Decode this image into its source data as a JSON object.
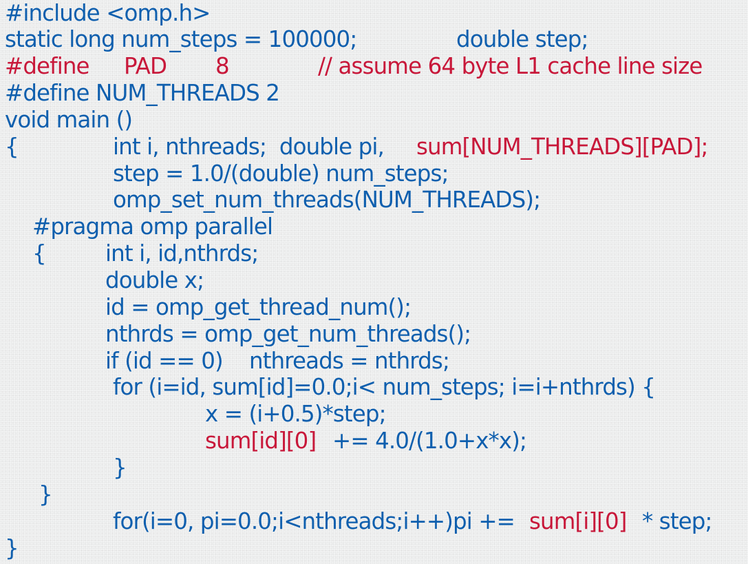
{
  "colors": {
    "code_blue": "#0f5fae",
    "highlight_red": "#c8183a",
    "background": "#f2f3f3"
  },
  "lines": {
    "l1": "#include <omp.h>",
    "l2a": "static long num_steps = 100000;",
    "l2b": "double step;",
    "l3a": "#define",
    "l3b": "PAD",
    "l3c": "8",
    "l3d": "// assume 64 byte L1 cache line size",
    "l4": "#define NUM_THREADS 2",
    "l5": "void main ()",
    "l6a": "{",
    "l6b": "int i, nthreads;  double pi,",
    "l6c": "sum[NUM_THREADS][PAD];",
    "l7": "step = 1.0/(double) num_steps;",
    "l8": "omp_set_num_threads(NUM_THREADS);",
    "l9": "#pragma omp parallel",
    "l10a": "{",
    "l10b": "int i, id,nthrds;",
    "l11": "double x;",
    "l12": "id = omp_get_thread_num();",
    "l13": "nthrds = omp_get_num_threads();",
    "l14a": "if (id == 0)",
    "l14b": "nthreads = nthrds;",
    "l15": "for (i=id, sum[id]=0.0;i< num_steps; i=i+nthrds) {",
    "l16": "x = (i+0.5)*step;",
    "l17a": "sum[id][0]",
    "l17b": "+= 4.0/(1.0+x*x);",
    "l18": "}",
    "l19": "}",
    "l20a": "for(i=0, pi=0.0;i<nthreads;i++)pi +=",
    "l20b": "sum[i][0]",
    "l20c": "* step;",
    "l21": "}"
  }
}
